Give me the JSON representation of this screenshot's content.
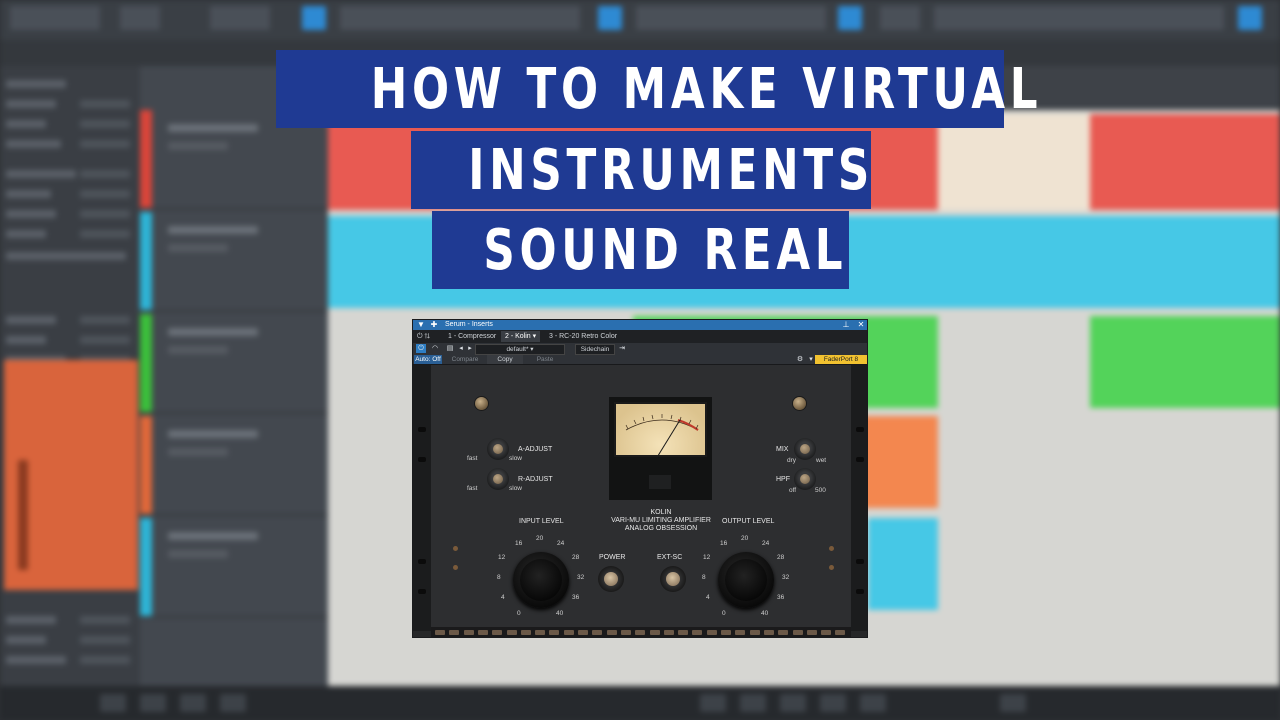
{
  "title": {
    "line1": "HOW TO MAKE VIRTUAL",
    "line2": "INSTRUMENTS",
    "line3": "SOUND REAL"
  },
  "plugin_window": {
    "title": "Serum - Inserts",
    "tabs": [
      "1 - Compressor",
      "2 - Kolin",
      "3 - RC-20 Retro Color"
    ],
    "active_tab": "2 - Kolin",
    "auto_label": "Auto: Off",
    "preset": "default*",
    "compare_label": "Compare",
    "copy_label": "Copy",
    "paste_label": "Paste",
    "sidechain_label": "Sidechain",
    "device_label": "FaderPort 8"
  },
  "unit": {
    "name": "KOLIN",
    "subtitle": "VARI-MU LIMITING AMPLIFIER",
    "brand": "ANALOG OBSESSION",
    "a_adjust": "A-ADJUST",
    "r_adjust": "R-ADJUST",
    "fast": "fast",
    "slow": "slow",
    "mix": "MIX",
    "dry": "dry",
    "wet": "wet",
    "hpf": "HPF",
    "off": "off",
    "hpf_max": "500",
    "input_level": "INPUT LEVEL",
    "output_level": "OUTPUT LEVEL",
    "power": "POWER",
    "ext_sc": "EXT-SC",
    "scale": [
      "0",
      "4",
      "8",
      "12",
      "16",
      "20",
      "24",
      "28",
      "32",
      "36",
      "40"
    ]
  },
  "colors": {
    "banner": "#1f3a93",
    "window_titlebar": "#2a6fb0",
    "faderport_badge": "#f2c230"
  }
}
